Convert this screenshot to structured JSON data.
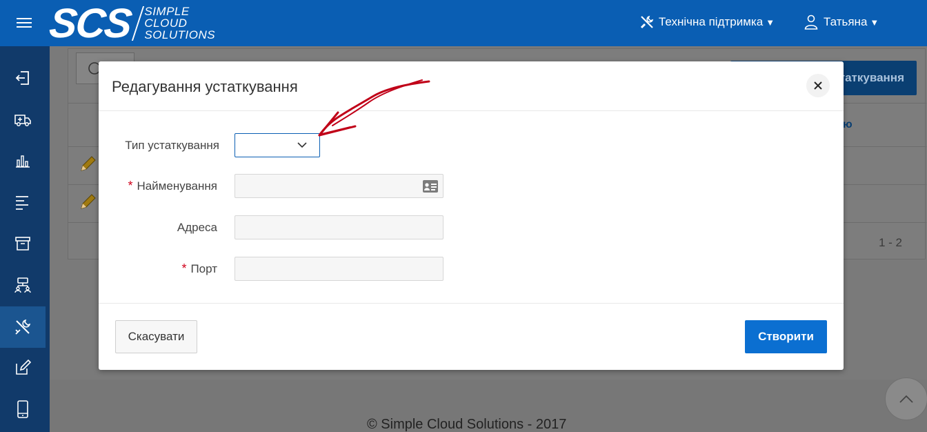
{
  "header": {
    "logo_main": "SCS",
    "logo_line1": "SIMPLE",
    "logo_line2": "CLOUD",
    "logo_line3": "SOLUTIONS",
    "support_label": "Технічна підтримка",
    "user_label": "Татьяна"
  },
  "sidebar": {
    "items": [
      {
        "icon": "sign-out-icon"
      },
      {
        "icon": "ambulance-icon"
      },
      {
        "icon": "bar-chart-icon"
      },
      {
        "icon": "align-left-icon"
      },
      {
        "icon": "archive-icon"
      },
      {
        "icon": "sitemap-icon"
      },
      {
        "icon": "tools-icon",
        "active": true
      },
      {
        "icon": "edit-icon"
      },
      {
        "icon": "mobile-icon"
      }
    ]
  },
  "background": {
    "create_button_label": "таткування",
    "column_header_partial": "ю",
    "pager": "1 - 2",
    "copyright": "© Simple Cloud Solutions - 2017"
  },
  "modal": {
    "title": "Редагування устаткування",
    "fields": {
      "type_label": "Тип устаткування",
      "type_value": "",
      "name_label": "Найменування",
      "name_required": "*",
      "name_value": "",
      "address_label": "Адреса",
      "address_value": "",
      "port_label": "Порт",
      "port_required": "*",
      "port_value": ""
    },
    "cancel_label": "Скасувати",
    "create_label": "Створити"
  },
  "colors": {
    "header_bg": "#0a5eb3",
    "sidebar_bg": "#113a6a",
    "primary_button": "#0b6fd1",
    "annotation_arrow": "#c00018"
  }
}
